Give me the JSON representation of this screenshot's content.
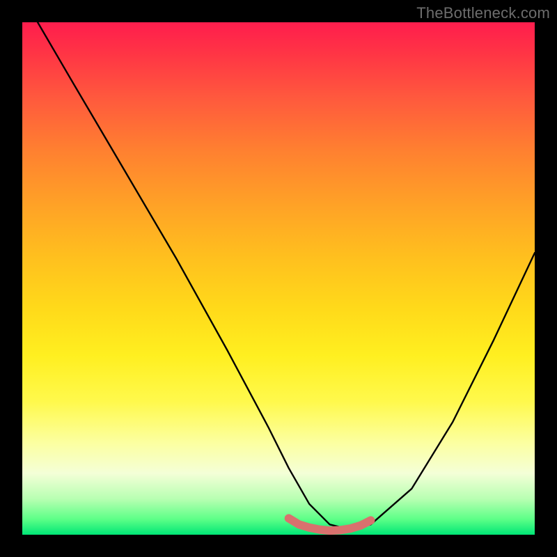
{
  "watermark": "TheBottleneck.com",
  "chart_data": {
    "type": "line",
    "title": "",
    "xlabel": "",
    "ylabel": "",
    "xlim": [
      0,
      100
    ],
    "ylim": [
      0,
      100
    ],
    "series": [
      {
        "name": "curve",
        "color": "#000000",
        "x": [
          3,
          10,
          20,
          30,
          40,
          48,
          52,
          56,
          60,
          64,
          68,
          76,
          84,
          92,
          100
        ],
        "values": [
          100,
          88,
          71,
          54,
          36,
          21,
          13,
          6,
          2,
          1,
          2,
          9,
          22,
          38,
          55
        ]
      },
      {
        "name": "highlight-band",
        "color": "#d9716e",
        "x": [
          52,
          54,
          56,
          58,
          60,
          62,
          64,
          66,
          68
        ],
        "values": [
          3.2,
          2.0,
          1.4,
          1.0,
          0.8,
          0.9,
          1.2,
          1.8,
          2.8
        ]
      }
    ],
    "background_gradient": {
      "top": "#ff1d4d",
      "mid": "#ffe01e",
      "bottom": "#00e676"
    }
  }
}
